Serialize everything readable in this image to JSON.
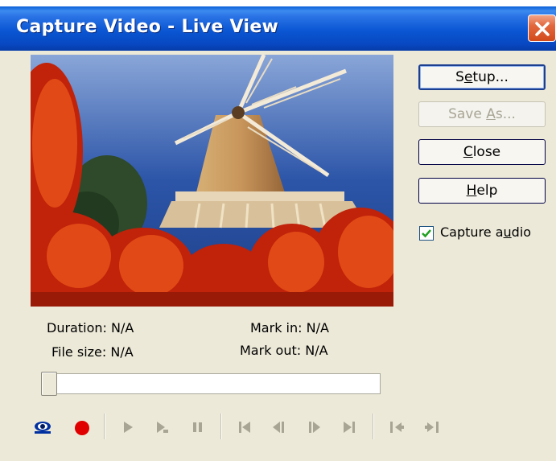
{
  "window": {
    "title": "Capture Video - Live View"
  },
  "buttons": {
    "setup_pre": "S",
    "setup_u": "e",
    "setup_post": "tup...",
    "saveas_pre": "Save ",
    "saveas_u": "A",
    "saveas_post": "s...",
    "close_u": "C",
    "close_post": "lose",
    "help_u": "H",
    "help_post": "elp"
  },
  "capture_audio": {
    "pre": "Capture a",
    "u": "u",
    "post": "dio",
    "checked": true
  },
  "info": {
    "duration": "Duration: N/A",
    "file_size": "File size: N/A",
    "mark_in": "Mark in: N/A",
    "mark_out": "Mark out: N/A"
  },
  "slider": {
    "position": 0
  },
  "toolbar": {
    "icons": [
      "preview-eye-icon",
      "record-icon",
      "play-icon",
      "play-step-icon",
      "pause-icon",
      "go-to-start-icon",
      "step-back-icon",
      "step-forward-icon",
      "go-to-end-icon",
      "mark-in-icon",
      "mark-out-icon"
    ]
  },
  "colors": {
    "titlebar": "#0a56d3",
    "record": "#e00000",
    "eye": "#0030a0",
    "disabled_icon": "#a8a595"
  }
}
